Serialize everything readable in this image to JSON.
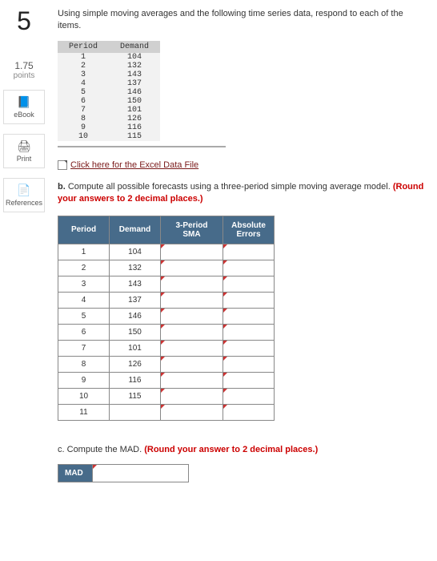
{
  "sidebar": {
    "question_number": "5",
    "points_value": "1.75",
    "points_label": "points",
    "tools": [
      {
        "icon": "📘",
        "label": "eBook"
      },
      {
        "icon": "🖨",
        "label": "Print"
      },
      {
        "icon": "📄",
        "label": "References"
      }
    ]
  },
  "intro": "Using simple moving averages and the following time series data, respond to each of the items.",
  "data_table": {
    "headers": [
      "Period",
      "Demand"
    ],
    "rows": [
      [
        "1",
        "104"
      ],
      [
        "2",
        "132"
      ],
      [
        "3",
        "143"
      ],
      [
        "4",
        "137"
      ],
      [
        "5",
        "146"
      ],
      [
        "6",
        "150"
      ],
      [
        "7",
        "101"
      ],
      [
        "8",
        "126"
      ],
      [
        "9",
        "116"
      ],
      [
        "10",
        "115"
      ]
    ]
  },
  "excel_link": "Click here for the Excel Data File",
  "part_b": {
    "label": "b.",
    "text": "Compute all possible forecasts using a three-period simple moving average model.",
    "round": "(Round your answers to 2 decimal places.)"
  },
  "answer_table": {
    "headers": [
      "Period",
      "Demand",
      "3-Period SMA",
      "Absolute Errors"
    ],
    "rows": [
      {
        "period": "1",
        "demand": "104"
      },
      {
        "period": "2",
        "demand": "132"
      },
      {
        "period": "3",
        "demand": "143"
      },
      {
        "period": "4",
        "demand": "137"
      },
      {
        "period": "5",
        "demand": "146"
      },
      {
        "period": "6",
        "demand": "150"
      },
      {
        "period": "7",
        "demand": "101"
      },
      {
        "period": "8",
        "demand": "126"
      },
      {
        "period": "9",
        "demand": "116"
      },
      {
        "period": "10",
        "demand": "115"
      },
      {
        "period": "11",
        "demand": ""
      }
    ]
  },
  "part_c": {
    "label": "c.",
    "text": "Compute the MAD.",
    "round": "(Round your answer to 2 decimal places.)"
  },
  "mad_label": "MAD"
}
